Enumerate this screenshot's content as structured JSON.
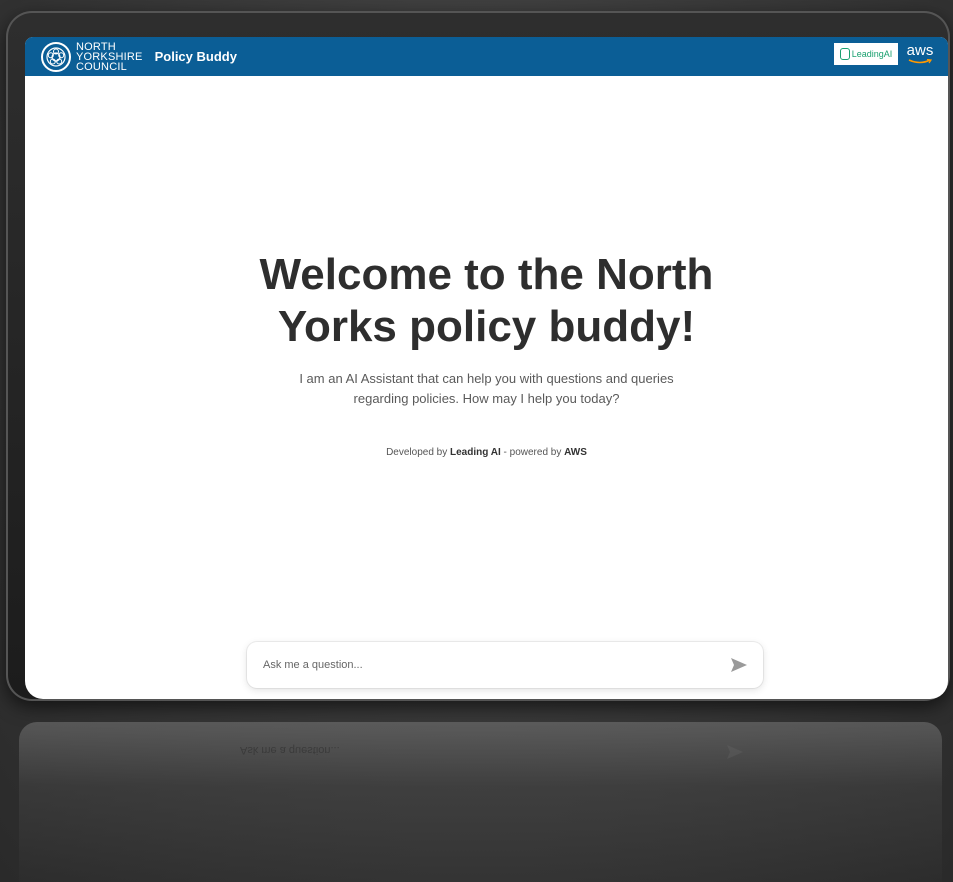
{
  "header": {
    "council_line1": "NORTH",
    "council_line2": "YORKSHIRE",
    "council_line3": "COUNCIL",
    "app_title": "Policy Buddy",
    "leading_ai_logo": "LeadingAI",
    "aws_logo": "aws",
    "bar_color": "#0b5e96"
  },
  "hero": {
    "title": "Welcome to the North Yorks policy buddy!",
    "subtitle": "I am an AI Assistant that can help you with questions and queries regarding policies. How may I help you today?",
    "credit_prefix": "Developed by",
    "credit_dev": "Leading AI",
    "credit_mid": "- powered by",
    "credit_power": "AWS"
  },
  "chat": {
    "placeholder": "Ask me a question...",
    "send_icon": "send-arrow-icon"
  },
  "reflection": {
    "ghost_text": "Ask me a question..."
  }
}
